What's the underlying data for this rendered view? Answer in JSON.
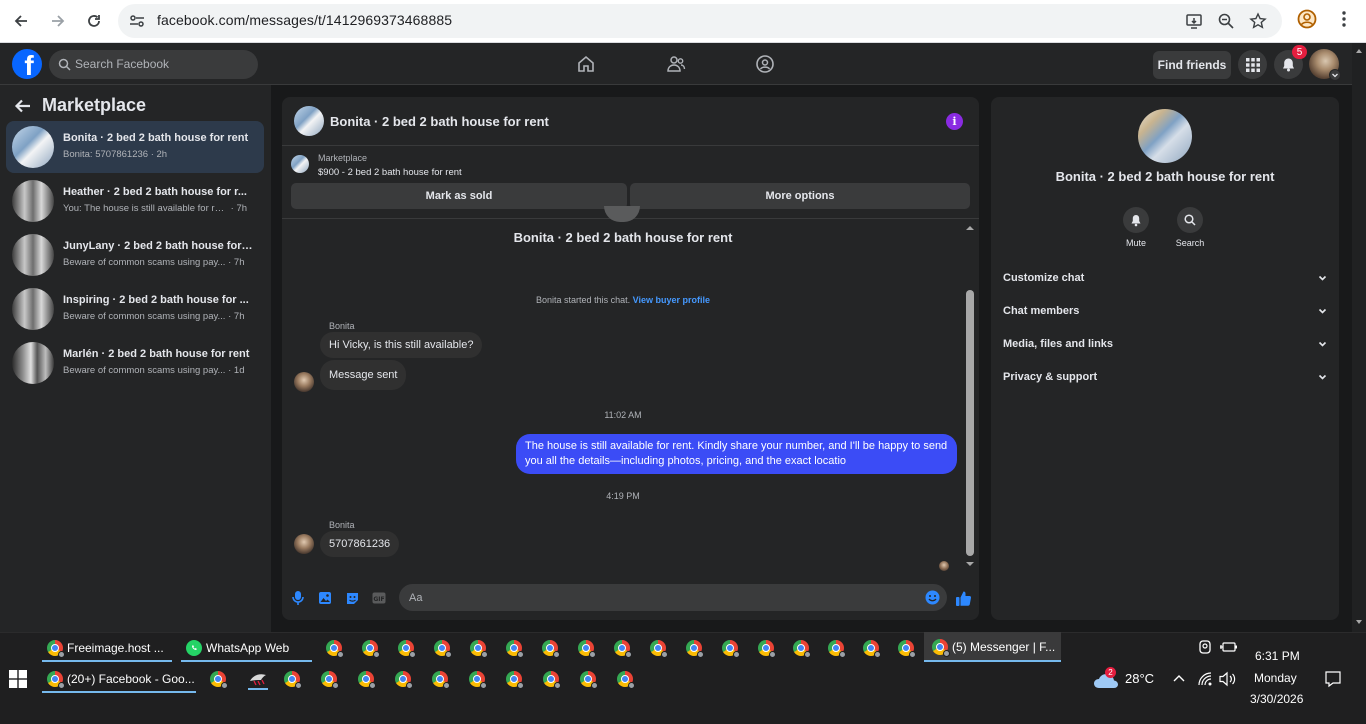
{
  "browser": {
    "url": "facebook.com/messages/t/1412969373468885"
  },
  "fb": {
    "search_placeholder": "Search Facebook",
    "find_friends": "Find friends",
    "notification_count": "5"
  },
  "sidebar": {
    "title": "Marketplace",
    "conversations": [
      {
        "name": "Bonita · 2 bed 2 bath house for rent",
        "preview": "Bonita: 5707861236",
        "time": "2h"
      },
      {
        "name": "Heather · 2 bed 2 bath house for r...",
        "preview": "You: The house is still available for ren...",
        "time": "7h"
      },
      {
        "name": "JunyLany · 2 bed 2 bath house for ...",
        "preview": "Beware of common scams using pay...",
        "time": "7h"
      },
      {
        "name": "Inspiring · 2 bed 2 bath house for ...",
        "preview": "Beware of common scams using pay...",
        "time": "7h"
      },
      {
        "name": "Marlén · 2 bed 2 bath house for rent",
        "preview": "Beware of common scams using pay...",
        "time": "1d"
      }
    ]
  },
  "chat": {
    "title": "Bonita · 2 bed 2 bath house for rent",
    "marketplace_label": "Marketplace",
    "listing": "$900 - 2 bed 2 bath house for rent",
    "mark_sold": "Mark as sold",
    "more_options": "More options",
    "body_title": "Bonita · 2 bed 2 bath house for rent",
    "started_text": "Bonita started this chat.",
    "view_profile": "View buyer profile",
    "sender1": "Bonita",
    "msg1": "Hi Vicky, is this still available?",
    "msg2": "Message sent",
    "time1": "11:02 AM",
    "my_msg": "The house is still available for rent. Kindly share your number, and I'll be happy to send you all the details—including photos, pricing, and the exact locatio",
    "time2": "4:19 PM",
    "sender2": "Bonita",
    "msg3": "5707861236",
    "input_placeholder": "Aa"
  },
  "right_panel": {
    "title": "Bonita · 2 bed 2 bath house for rent",
    "mute": "Mute",
    "search": "Search",
    "sections": [
      "Customize chat",
      "Chat members",
      "Media, files and links",
      "Privacy & support"
    ]
  },
  "taskbar": {
    "row1": [
      "Freeimage.host ...",
      "WhatsApp Web",
      "(5) Messenger | F..."
    ],
    "row2": [
      "(20+) Facebook - Goo..."
    ],
    "temperature": "28°C",
    "weather_badge": "2",
    "time": "6:31 PM",
    "day": "Monday",
    "date": "3/30/2026"
  }
}
